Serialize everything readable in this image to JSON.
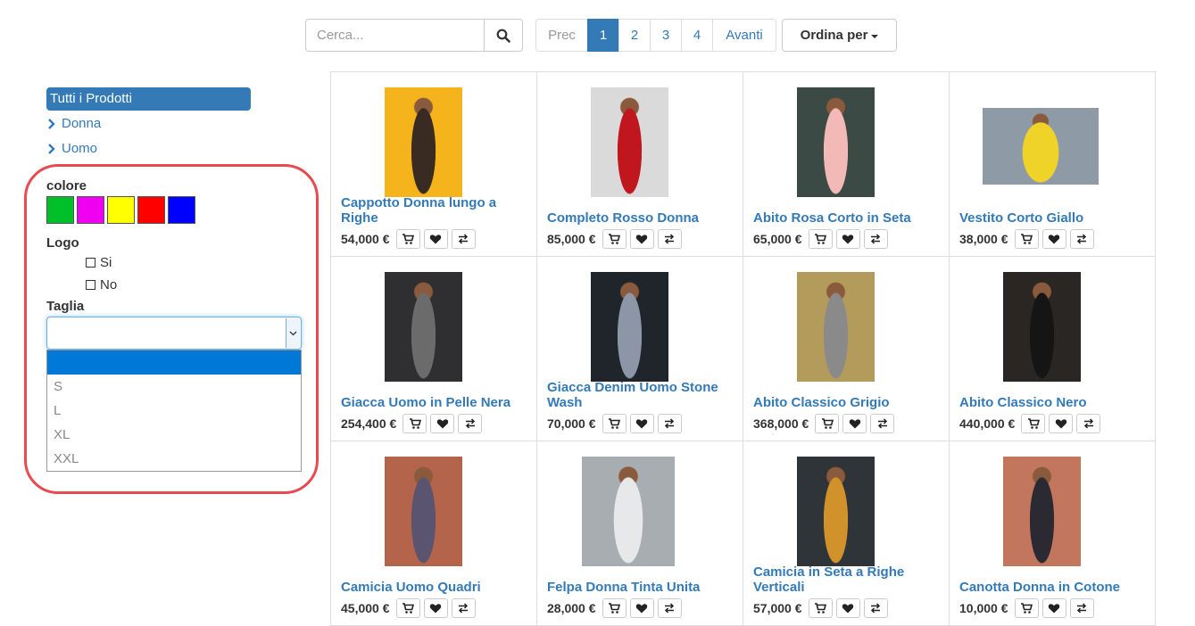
{
  "search": {
    "placeholder": "Cerca..."
  },
  "pagination": {
    "prev": "Prec",
    "pages": [
      "1",
      "2",
      "3",
      "4"
    ],
    "active_page": "1",
    "next": "Avanti"
  },
  "sort": {
    "label": "Ordina per"
  },
  "sidebar": {
    "categories": {
      "all": "Tutti i Prodotti",
      "items": [
        "Donna",
        "Uomo"
      ]
    },
    "filters": {
      "color_label": "colore",
      "colors": [
        "#00c02a",
        "#f000f0",
        "#ffff00",
        "#ff0000",
        "#0000ff"
      ],
      "logo_label": "Logo",
      "logo_options": [
        "Si",
        "No"
      ],
      "size_label": "Taglia",
      "size_selected": "",
      "size_options": [
        "",
        "S",
        "L",
        "XL",
        "XXL"
      ]
    }
  },
  "products": [
    {
      "name": "Cappotto Donna lungo a Righe",
      "price": "54,000 €",
      "photo_colors": [
        "#f5b31c",
        "#3a2b22"
      ]
    },
    {
      "name": "Completo Rosso Donna",
      "price": "85,000 €",
      "photo_colors": [
        "#dadada",
        "#c0171f"
      ]
    },
    {
      "name": "Abito Rosa Corto in Seta",
      "price": "65,000 €",
      "photo_colors": [
        "#3b4a44",
        "#f3b9b6"
      ]
    },
    {
      "name": "Vestito Corto Giallo",
      "price": "38,000 €",
      "photo_colors": [
        "#8e9ba6",
        "#f0d329"
      ]
    },
    {
      "name": "Giacca Uomo in Pelle Nera",
      "price": "254,400 €",
      "photo_colors": [
        "#2f2f31",
        "#6b6b6b"
      ]
    },
    {
      "name": "Giacca Denim Uomo Stone Wash",
      "price": "70,000 €",
      "photo_colors": [
        "#20252c",
        "#8c96a6"
      ]
    },
    {
      "name": "Abito Classico Grigio",
      "price": "368,000 €",
      "photo_colors": [
        "#b39b5c",
        "#8a8a8a"
      ]
    },
    {
      "name": "Abito Classico Nero",
      "price": "440,000 €",
      "photo_colors": [
        "#2a2623",
        "#151515"
      ]
    },
    {
      "name": "Camicia Uomo Quadri",
      "price": "45,000 €",
      "photo_colors": [
        "#b4644a",
        "#5b5470"
      ]
    },
    {
      "name": "Felpa Donna Tinta Unita",
      "price": "28,000 €",
      "photo_colors": [
        "#a8adb2",
        "#e6e8ea"
      ]
    },
    {
      "name": "Camicia in Seta a Righe Verticali",
      "price": "57,000 €",
      "photo_colors": [
        "#2f3439",
        "#d1922c"
      ]
    },
    {
      "name": "Canotta Donna in Cotone",
      "price": "10,000 €",
      "photo_colors": [
        "#c3765e",
        "#2b2a33"
      ]
    }
  ]
}
